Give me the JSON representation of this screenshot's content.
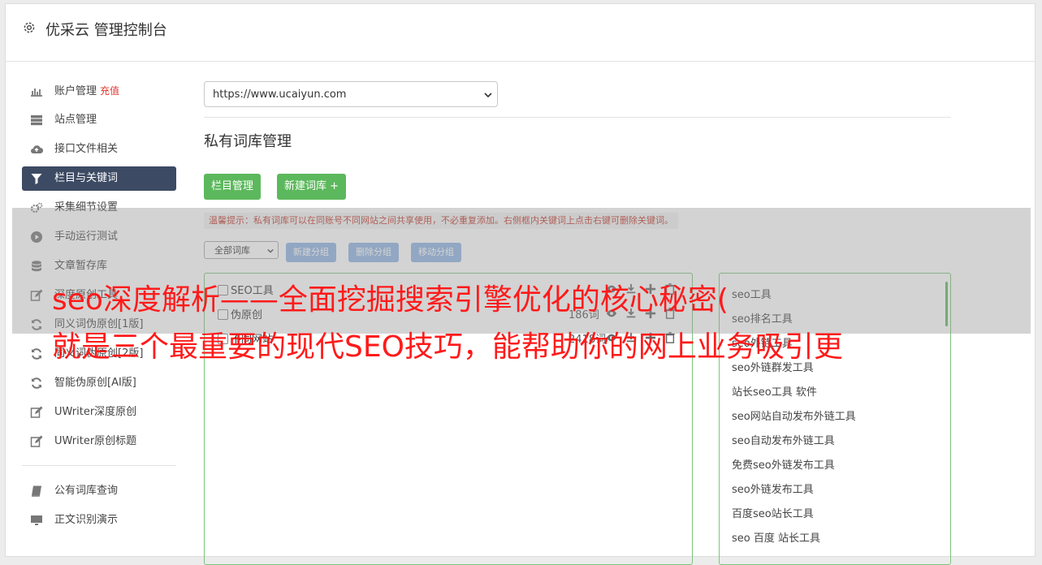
{
  "header": {
    "title": "优采云 管理控制台"
  },
  "sidebar": {
    "items": [
      {
        "label": "账户管理",
        "badge": "充值",
        "icon": "bar-chart-icon"
      },
      {
        "label": "站点管理",
        "icon": "server-icon"
      },
      {
        "label": "接口文件相关",
        "icon": "cloud-upload-icon"
      },
      {
        "label": "栏目与关键词",
        "icon": "filter-icon",
        "active": true
      },
      {
        "label": "采集细节设置",
        "icon": "gears-icon"
      },
      {
        "label": "手动运行测试",
        "icon": "play-circle-icon"
      },
      {
        "label": "文章暂存库",
        "icon": "database-icon"
      },
      {
        "label": "深度原创工具",
        "icon": "edit-icon"
      },
      {
        "label": "同义词伪原创[1版]",
        "icon": "refresh-icon"
      },
      {
        "label": "同义词伪原创[2版]",
        "icon": "refresh-icon"
      },
      {
        "label": "智能伪原创[AI版]",
        "icon": "refresh-icon"
      },
      {
        "label": "UWriter深度原创",
        "icon": "edit-icon"
      },
      {
        "label": "UWriter原创标题",
        "icon": "edit-icon"
      }
    ],
    "items2": [
      {
        "label": "公有词库查询",
        "icon": "book-icon"
      },
      {
        "label": "正文识别演示",
        "icon": "monitor-icon"
      }
    ]
  },
  "main": {
    "site_select": "https://www.ucaiyun.com",
    "section_title": "私有词库管理",
    "btn_columns": "栏目管理",
    "btn_new_lib": "新建词库 +",
    "tip": "温馨提示：私有词库可以在同账号不同网站之间共享使用，不必重复添加。右侧框内关键词上点击右键可删除关键词。",
    "lib_filter": "全部词库",
    "btn_new_group": "新建分组",
    "btn_del_group": "删除分组",
    "btn_move_group": "移动分组",
    "libs": [
      {
        "name": "SEO工具",
        "count": ""
      },
      {
        "name": "伪原创",
        "count": "186词"
      },
      {
        "name": "不同网站",
        "count": "2418词"
      }
    ],
    "keywords": [
      "seo工具",
      "seo排名工具",
      "seo外链工具",
      "seo外链群发工具",
      "站长seo工具 软件",
      "seo网站自动发布外链工具",
      "seo自动发布外链工具",
      "免费seo外链发布工具",
      "seo外链发布工具",
      "百度seo站长工具",
      "seo 百度 站长工具"
    ]
  },
  "overlay": {
    "line1": "seo深度解析——全面挖掘搜索引擎优化的核心秘密(",
    "line2": "就是三个最重要的现代SEO技巧，能帮助你的网上业务吸引更"
  },
  "colors": {
    "active_bg": "#3c4a63",
    "green": "#5cb85c",
    "light_blue": "#8fb3e3",
    "headline_red": "#ff1a1a"
  }
}
